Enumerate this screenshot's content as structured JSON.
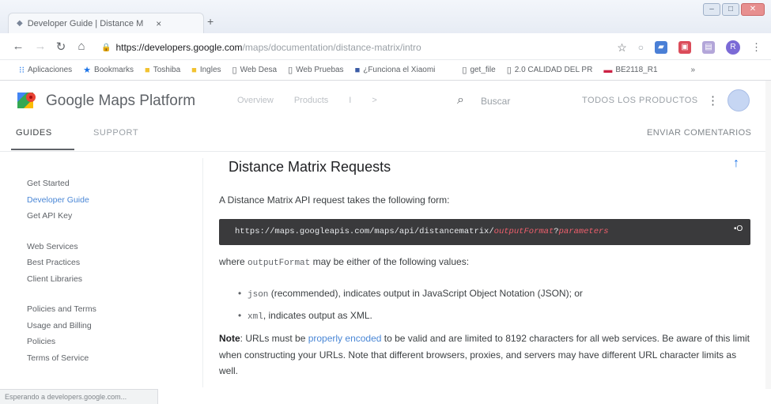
{
  "browser": {
    "tab_title": "Developer Guide  |  Distance M",
    "tab_close": "×",
    "new_tab": "+",
    "url_host": "https://developers.google.com",
    "url_path": "/maps/documentation/distance-matrix/intro",
    "bookmarks": [
      {
        "label": "Aplicaciones",
        "icon": "apps-icon"
      },
      {
        "label": "Bookmarks",
        "icon": "star-icon"
      },
      {
        "label": "Toshiba",
        "icon": "folder-icon"
      },
      {
        "label": "Ingles",
        "icon": "folder-icon"
      },
      {
        "label": "Web Desa",
        "icon": "page-icon"
      },
      {
        "label": "Web Pruebas",
        "icon": "page-icon"
      },
      {
        "label": "¿Funciona el Xiaomi",
        "icon": "site-icon"
      },
      {
        "label": "get_file",
        "icon": "page-icon"
      },
      {
        "label": "2.0 CALIDAD DEL PR",
        "icon": "page-icon"
      },
      {
        "label": "BE2118_R1",
        "icon": "site-icon"
      }
    ],
    "bookmarks_more": "»",
    "status": "Esperando a developers.google.com..."
  },
  "header": {
    "title": "Google Maps Platform",
    "nav": [
      "Overview",
      "Products",
      "I",
      ">"
    ],
    "search_placeholder": "Buscar",
    "all_products": "TODOS LOS PRODUCTOS"
  },
  "subnav": {
    "guides": "GUIDES",
    "support": "SUPPORT",
    "feedback": "ENVIAR COMENTARIOS"
  },
  "sidebar": {
    "group1": [
      "Get Started",
      "Developer Guide",
      "Get API Key"
    ],
    "group2": [
      "Web Services",
      "Best Practices",
      "Client Libraries"
    ],
    "group3": [
      "Policies and Terms",
      "Usage and Billing",
      "Policies",
      "Terms of Service"
    ]
  },
  "content": {
    "heading": "Distance Matrix Requests",
    "intro": "A Distance Matrix API request takes the following form:",
    "code_base": "https://maps.googleapis.com/maps/api/distancematrix/",
    "code_var1": "outputFormat",
    "code_q": "?",
    "code_var2": "parameters",
    "where_pre": "where ",
    "where_code": "outputFormat",
    "where_post": " may be either of the following values:",
    "bullet1_code": "json",
    "bullet1_text": " (recommended), indicates output in JavaScript Object Notation (JSON); or",
    "bullet2_code": "xml",
    "bullet2_text": ", indicates output as XML.",
    "note_label": "Note",
    "note_pre": ": URLs must be ",
    "note_link": "properly encoded",
    "note_post": " to be valid and are limited to 8192 characters for all web services. Be aware of this limit when constructing your URLs. Note that different browsers, proxies, and servers may have different URL character limits as well."
  }
}
